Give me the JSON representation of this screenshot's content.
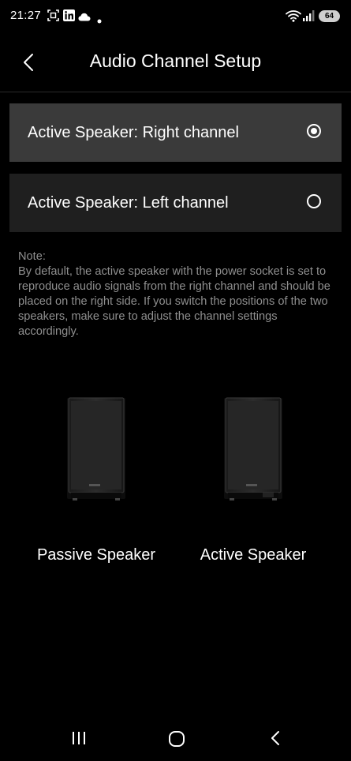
{
  "status_bar": {
    "time": "21:27",
    "battery": "64",
    "icons": [
      "screenshot-icon",
      "linkedin-icon",
      "cloud-icon",
      "notification-dot-icon",
      "wifi-icon",
      "signal-icon",
      "battery-icon"
    ]
  },
  "header": {
    "title": "Audio Channel Setup",
    "back_icon": "chevron-left-icon"
  },
  "options": [
    {
      "label": "Active Speaker: Right channel",
      "selected": true
    },
    {
      "label": "Active Speaker: Left channel",
      "selected": false
    }
  ],
  "note": {
    "heading": "Note:",
    "body": "By default, the active speaker with the power socket is set to reproduce audio signals from the right channel and should be placed on the right side. If you switch the positions of the two speakers, make sure to adjust the channel settings accordingly."
  },
  "speakers": [
    {
      "caption": "Passive Speaker"
    },
    {
      "caption": "Active Speaker"
    }
  ],
  "nav_bar": {
    "icons": [
      "recent-apps-icon",
      "home-icon",
      "back-icon"
    ]
  },
  "colors": {
    "background": "#000000",
    "selected_row": "#3a3a3a",
    "unselected_row": "#1f1f1f",
    "note_text": "#8f8f8f"
  }
}
